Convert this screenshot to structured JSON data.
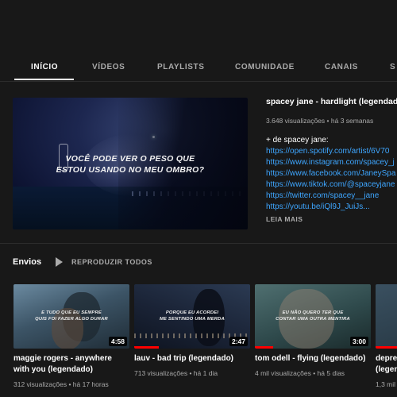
{
  "tabs": [
    {
      "label": "INÍCIO",
      "active": true
    },
    {
      "label": "VÍDEOS",
      "active": false
    },
    {
      "label": "PLAYLISTS",
      "active": false
    },
    {
      "label": "COMUNIDADE",
      "active": false
    },
    {
      "label": "CANAIS",
      "active": false
    },
    {
      "label": "S",
      "active": false
    }
  ],
  "featured": {
    "caption_line1": "VOCÊ PODE VER O PESO QUE",
    "caption_line2": "ESTOU USANDO NO MEU OMBRO?",
    "title": "spacey jane - hardlight (legendado)",
    "meta": "3.648 visualizações • há 3 semanas",
    "description": "+ de spacey jane:",
    "links": [
      "https://open.spotify.com/artist/6V70",
      "https://www.instagram.com/spacey_j",
      "https://www.facebook.com/JaneySpa",
      "https://www.tiktok.com/@spaceyjane",
      "https://twitter.com/spacey__jane",
      "https://youtu.be/iQl9J_JuiJs..."
    ],
    "more_label": "LEIA MAIS"
  },
  "uploads": {
    "title": "Envios",
    "play_all_label": "REPRODUZIR TODOS",
    "videos": [
      {
        "caption_line1": "E TUDO QUE EU SEMPRE",
        "caption_line2": "QUIS FOI FAZER ALGO DURAR",
        "duration": "4:58",
        "title_line1": "maggie rogers - anywhere",
        "title_line2": "with you (legendado)",
        "meta": "312 visualizações • há 17 horas",
        "progress": 0
      },
      {
        "caption_line1": "PORQUE EU ACORDEI",
        "caption_line2": "ME SENTINDO UMA MERDA",
        "duration": "2:47",
        "title_line1": "lauv - bad trip (legendado)",
        "title_line2": "",
        "meta": "713 visualizações • há 1 dia",
        "progress": 0.21
      },
      {
        "caption_line1": "EU NÃO QUERO TER QUE",
        "caption_line2": "CONTAR UMA OUTRA MENTIRA",
        "duration": "3:00",
        "title_line1": "tom odell - flying (legendado)",
        "title_line2": "",
        "meta": "4 mil visualizações • há 5 dias",
        "progress": 0.16
      },
      {
        "caption_line1": "",
        "caption_line2": "",
        "duration": "",
        "title_line1": "depres",
        "title_line2": "(legen",
        "meta": "1,3 mil",
        "progress": 0.5
      }
    ]
  },
  "colors": {
    "background": "#181818",
    "link": "#3ea6ff",
    "progress": "#ff0000",
    "muted": "#aaaaaa"
  }
}
